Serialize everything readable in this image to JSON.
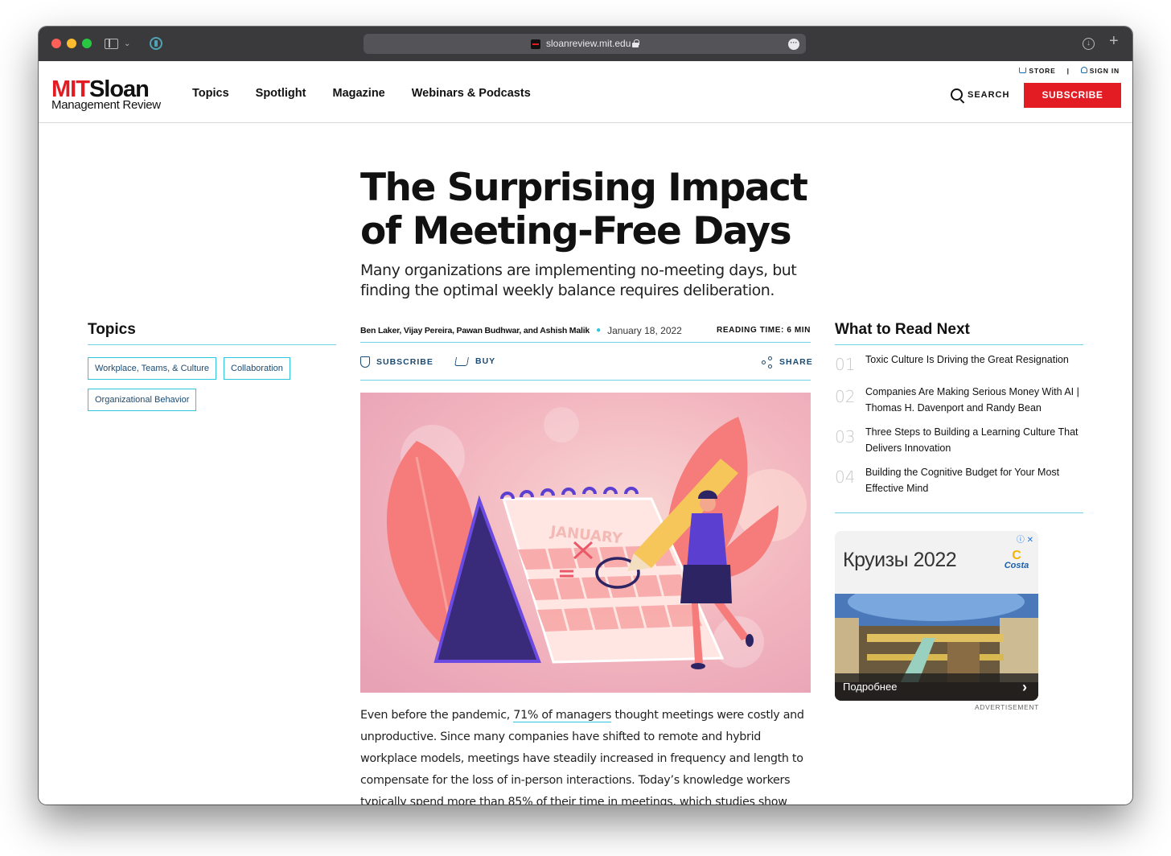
{
  "browser": {
    "url": "sloanreview.mit.edu"
  },
  "header": {
    "logo_mit": "MIT",
    "logo_sloan": "Sloan",
    "logo_sub": "Management Review",
    "nav": [
      {
        "label": "Topics"
      },
      {
        "label": "Spotlight"
      },
      {
        "label": "Magazine"
      },
      {
        "label": "Webinars & Podcasts"
      }
    ],
    "store_label": "STORE",
    "separator": "|",
    "signin_label": "SIGN IN",
    "search_label": "SEARCH",
    "subscribe_label": "SUBSCRIBE"
  },
  "article": {
    "title": "The Surprising Impact of Meeting-Free Days",
    "dek": "Many organizations are implementing no-meeting days, but finding the optimal weekly balance requires deliberation.",
    "authors": "Ben Laker, Vijay Pereira, Pawan Budhwar, and Ashish Malik",
    "date": "January 18, 2022",
    "reading_time": "READING TIME: 6 MIN",
    "actions": {
      "subscribe": "SUBSCRIBE",
      "buy": "BUY",
      "share": "SHARE"
    },
    "hero_calendar_month": "JANUARY",
    "body_before_link": "Even before the pandemic, ",
    "body_link": "71% of managers",
    "body_after_link": " thought meetings were costly and unproductive. Since many companies have shifted to remote and hybrid workplace models, meetings have steadily increased in frequency and length to compensate for the loss of in-person interactions. Today’s knowledge workers typically spend more than 85% of their time in meetings, which studies show"
  },
  "topics": {
    "heading": "Topics",
    "tags": [
      {
        "label": "Workplace, Teams, & Culture"
      },
      {
        "label": "Collaboration"
      },
      {
        "label": "Organizational Behavior"
      }
    ]
  },
  "read_next": {
    "heading": "What to Read Next",
    "items": [
      {
        "num": "01",
        "title": "Toxic Culture Is Driving the Great Resignation"
      },
      {
        "num": "02",
        "title": "Companies Are Making Serious Money With AI | Thomas H. Davenport and Randy Bean"
      },
      {
        "num": "03",
        "title": "Three Steps to Building a Learning Culture That Delivers Innovation"
      },
      {
        "num": "04",
        "title": "Building the Cognitive Budget for Your Most Effective Mind"
      }
    ]
  },
  "ad": {
    "title": "Круизы 2022",
    "brand": "Costa",
    "cta": "Подробнее",
    "label": "ADVERTISEMENT"
  },
  "colors": {
    "brand_red": "#e31b23",
    "accent_cyan": "#2ec6de",
    "link_navy": "#1b4a72"
  }
}
